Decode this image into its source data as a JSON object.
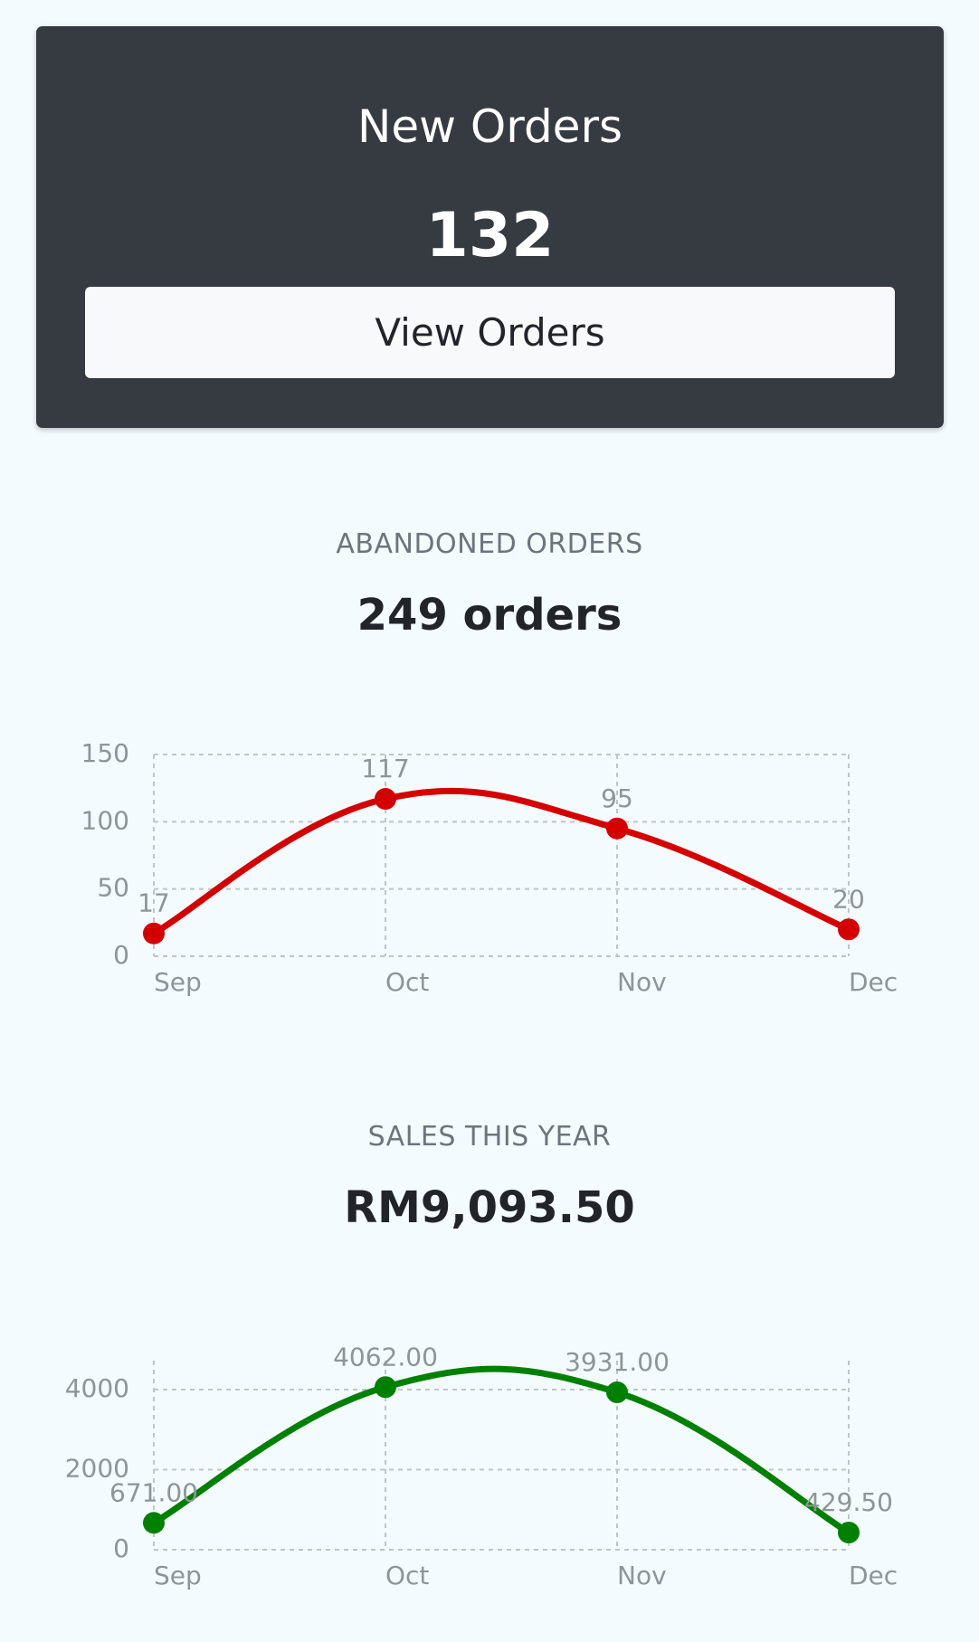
{
  "new_orders": {
    "title": "New Orders",
    "count": "132",
    "button_label": "View Orders"
  },
  "abandoned": {
    "label": "ABANDONED ORDERS",
    "value": "249 orders"
  },
  "sales": {
    "label": "SALES THIS YEAR",
    "value": "RM9,093.50"
  },
  "chart_data": [
    {
      "type": "line",
      "categories": [
        "Sep",
        "Oct",
        "Nov",
        "Dec"
      ],
      "series": [
        {
          "values": [
            17,
            117,
            95,
            20
          ],
          "data_labels": [
            "17",
            "117",
            "95",
            "20"
          ],
          "color": "#d40000"
        }
      ],
      "ylim": [
        0,
        150
      ],
      "yticks": [
        0,
        50,
        100,
        150
      ],
      "ytick_labels": [
        "0",
        "50",
        "100",
        "150"
      ],
      "grid": true
    },
    {
      "type": "line",
      "categories": [
        "Sep",
        "Oct",
        "Nov",
        "Dec"
      ],
      "series": [
        {
          "values": [
            671.0,
            4062.0,
            3931.0,
            429.5
          ],
          "data_labels": [
            "671.00",
            "4062.00",
            "3931.00",
            "429.50"
          ],
          "color": "#008000"
        }
      ],
      "ylim": [
        0,
        4000
      ],
      "yticks": [
        0,
        2000,
        4000
      ],
      "ytick_labels": [
        "0",
        "2000",
        "4000"
      ],
      "grid": true
    }
  ]
}
